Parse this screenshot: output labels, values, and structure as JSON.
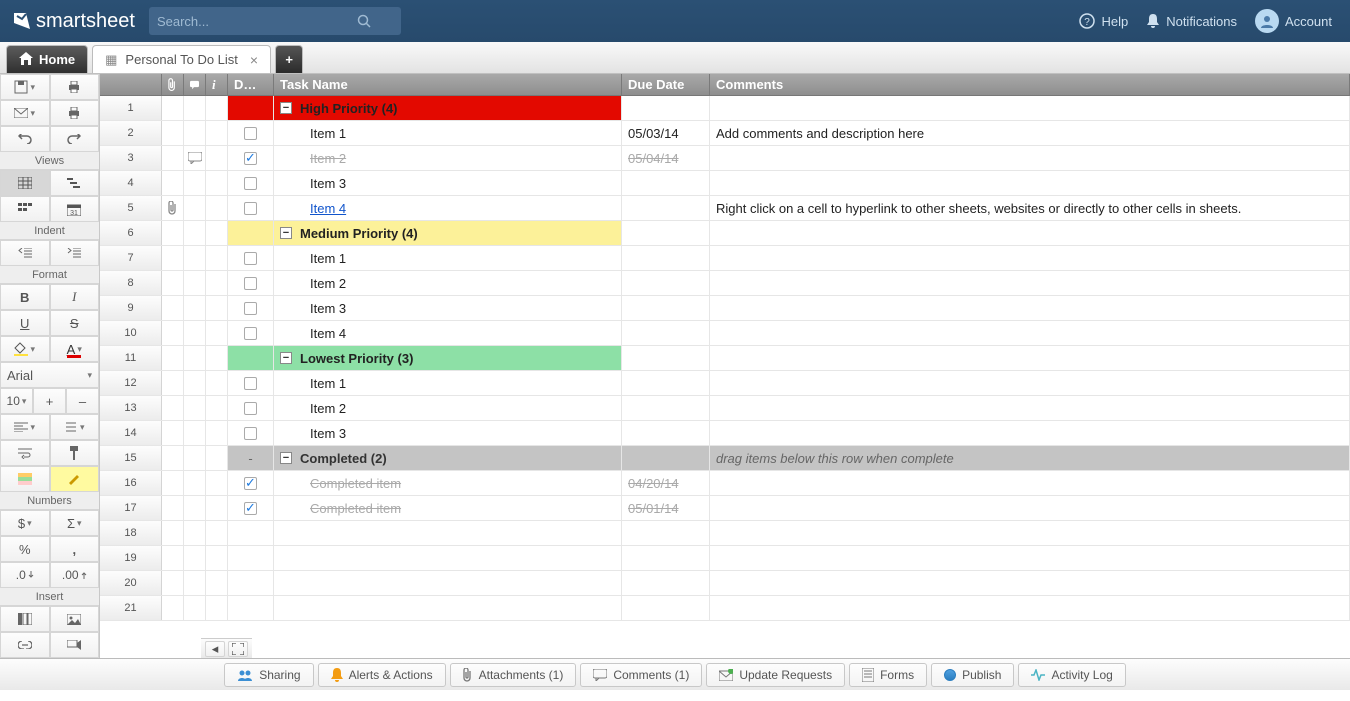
{
  "brand": "smartsheet",
  "search": {
    "placeholder": "Search..."
  },
  "top": {
    "help": "Help",
    "notifications": "Notifications",
    "account": "Account"
  },
  "tabs": {
    "home": "Home",
    "active": "Personal To Do List"
  },
  "home_icon": "⌂",
  "sidelabels": {
    "views": "Views",
    "indent": "Indent",
    "format": "Format",
    "numbers": "Numbers",
    "insert": "Insert"
  },
  "side": {
    "font": "Arial",
    "fontsize": "10",
    "plus": "+",
    "minus": "–",
    "bold": "B",
    "italic": "I",
    "underline": "U",
    "strike": "S",
    "currency": "$",
    "sigma": "Σ",
    "percent": "%",
    "comma": ",",
    "decmore": ".0",
    "decless": ".00"
  },
  "cols": {
    "attach": "",
    "disc": "",
    "info": "i",
    "done": "D…",
    "task": "Task Name",
    "due": "Due Date",
    "comments": "Comments"
  },
  "rows": [
    {
      "type": "hdr",
      "color": "redhdr",
      "label": "High Priority (4)"
    },
    {
      "type": "item",
      "chk": false,
      "name": "Item 1",
      "due": "05/03/14",
      "comment": "Add comments and description here"
    },
    {
      "type": "item",
      "chk": true,
      "disc": true,
      "name": "Item 2",
      "due": "05/04/14",
      "strike": true
    },
    {
      "type": "item",
      "chk": false,
      "name": "Item 3"
    },
    {
      "type": "item",
      "chk": false,
      "attach": true,
      "link": true,
      "name": "Item 4",
      "comment": "Right click on a cell to hyperlink to other sheets, websites or directly to other cells in sheets."
    },
    {
      "type": "hdr",
      "color": "yelhdr",
      "label": "Medium Priority (4)"
    },
    {
      "type": "item",
      "chk": false,
      "name": "Item 1"
    },
    {
      "type": "item",
      "chk": false,
      "name": "Item 2"
    },
    {
      "type": "item",
      "chk": false,
      "name": "Item 3"
    },
    {
      "type": "item",
      "chk": false,
      "name": "Item 4"
    },
    {
      "type": "hdr",
      "color": "grnhdr",
      "label": "Lowest Priority (3)"
    },
    {
      "type": "item",
      "chk": false,
      "name": "Item 1"
    },
    {
      "type": "item",
      "chk": false,
      "name": "Item 2"
    },
    {
      "type": "item",
      "chk": false,
      "name": "Item 3"
    },
    {
      "type": "completed-hdr",
      "label": "Completed (2)",
      "hint": "drag items below this row when complete"
    },
    {
      "type": "item",
      "chk": true,
      "name": "Completed item",
      "due": "04/20/14",
      "strike": true
    },
    {
      "type": "item",
      "chk": true,
      "name": "Completed item",
      "due": "05/01/14",
      "strike": true
    },
    {
      "type": "empty"
    },
    {
      "type": "empty"
    },
    {
      "type": "empty"
    },
    {
      "type": "empty"
    }
  ],
  "bottom": {
    "sharing": "Sharing",
    "alerts": "Alerts & Actions",
    "attachments": "Attachments (1)",
    "comments": "Comments (1)",
    "update": "Update Requests",
    "forms": "Forms",
    "publish": "Publish",
    "activity": "Activity Log"
  }
}
